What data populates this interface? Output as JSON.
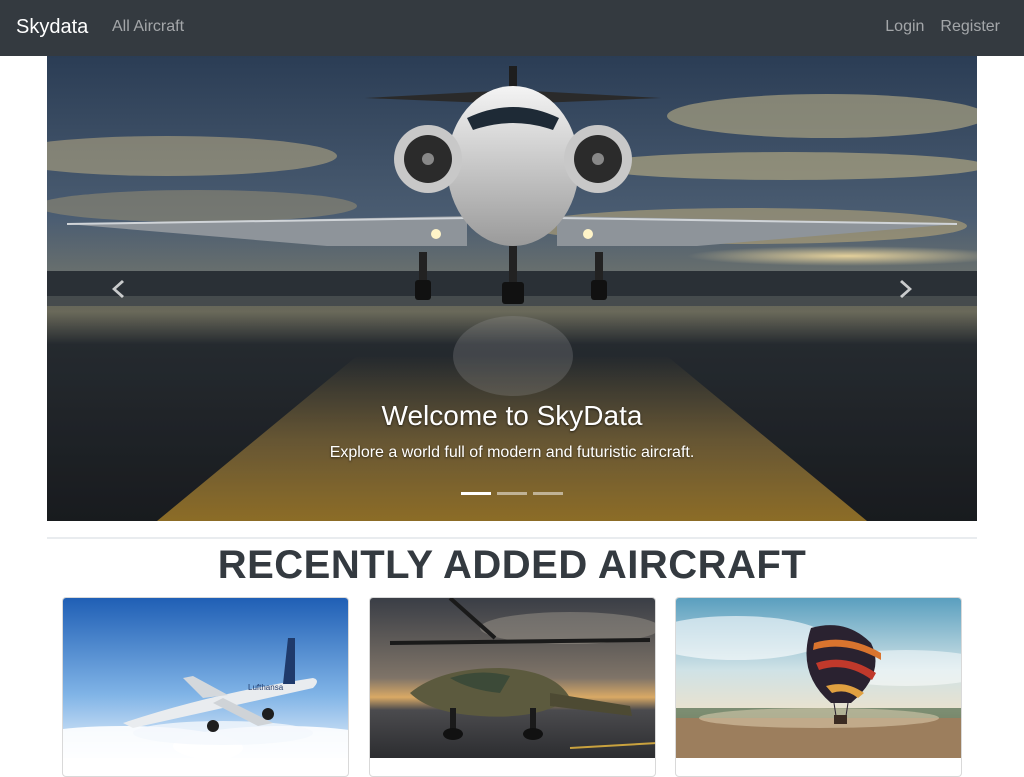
{
  "navbar": {
    "brand": "Skydata",
    "links": {
      "all_aircraft": "All Aircraft"
    },
    "right": {
      "login": "Login",
      "register": "Register"
    },
    "background": "#343a40"
  },
  "carousel": {
    "slides_count": 3,
    "active_index": 0,
    "caption": {
      "title": "Welcome to SkyData",
      "text": "Explore a world full of modern and futuristic aircraft."
    },
    "prev_icon": "chevron-left-icon",
    "next_icon": "chevron-right-icon"
  },
  "section": {
    "title": "RECENTLY ADDED AIRCRAFT"
  },
  "cards": [
    {
      "image": "airliner-in-clouds"
    },
    {
      "image": "military-helicopter"
    },
    {
      "image": "hot-air-balloon"
    }
  ]
}
